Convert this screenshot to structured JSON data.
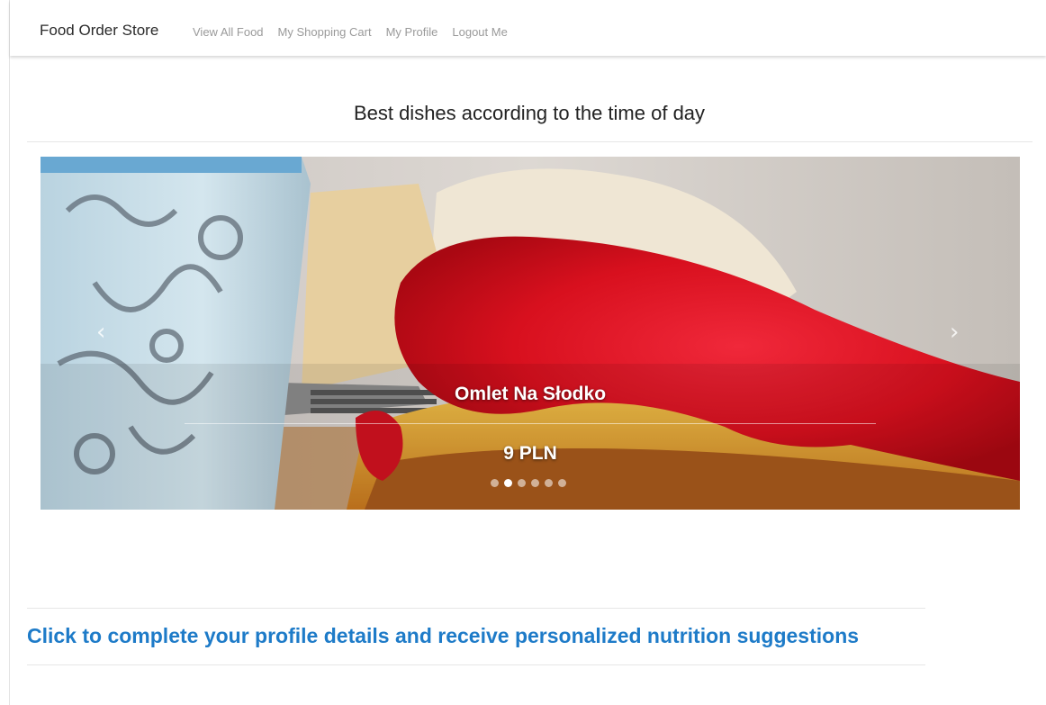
{
  "navbar": {
    "brand": "Food Order Store",
    "links": [
      {
        "label": "View All Food"
      },
      {
        "label": "My Shopping Cart"
      },
      {
        "label": "My Profile"
      },
      {
        "label": "Logout Me"
      }
    ]
  },
  "section": {
    "title": "Best dishes according to the time of day"
  },
  "carousel": {
    "slide_name": "Omlet Na Słodko",
    "slide_price": "9 PLN",
    "prev_icon": "‹",
    "next_icon": "›",
    "slide_count": 6,
    "active_index": 1
  },
  "cta": {
    "label": "Click to complete your profile details and receive personalized nutrition suggestions"
  },
  "colors": {
    "link_blue": "#1e7bc8",
    "nav_text": "#9a9a9a"
  }
}
